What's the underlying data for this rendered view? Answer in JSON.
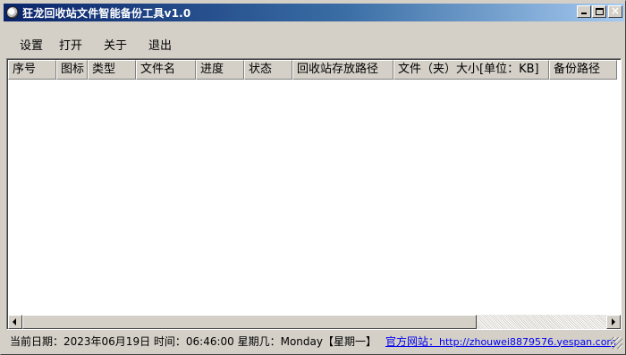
{
  "window": {
    "title": "狂龙回收站文件智能备份工具v1.0",
    "icon": "app-disc-icon",
    "controls": {
      "minimize_icon": "minimize-icon",
      "maximize_icon": "maximize-icon",
      "close_glyph": "×"
    }
  },
  "menu": {
    "items": [
      {
        "label": "设置"
      },
      {
        "label": "打开"
      },
      {
        "label": "关于"
      },
      {
        "label": "退出"
      }
    ]
  },
  "list": {
    "columns": [
      {
        "label": "序号"
      },
      {
        "label": "图标"
      },
      {
        "label": "类型"
      },
      {
        "label": "文件名"
      },
      {
        "label": "进度"
      },
      {
        "label": "状态"
      },
      {
        "label": "回收站存放路径"
      },
      {
        "label": "文件（夹）大小[单位：KB]"
      },
      {
        "label": "备份路径"
      }
    ],
    "rows": []
  },
  "statusbar": {
    "datetime_text": "当前日期：2023年06月19日 时间：06:46:00 星期几：Monday【星期一】",
    "site_label": "官方网站：",
    "site_url": "http://zhouwei8879576.yespan.com"
  },
  "colors": {
    "titlebar_start": "#0a246a",
    "titlebar_end": "#a6caf0",
    "face": "#d4d0c8",
    "link": "#0000ee"
  }
}
